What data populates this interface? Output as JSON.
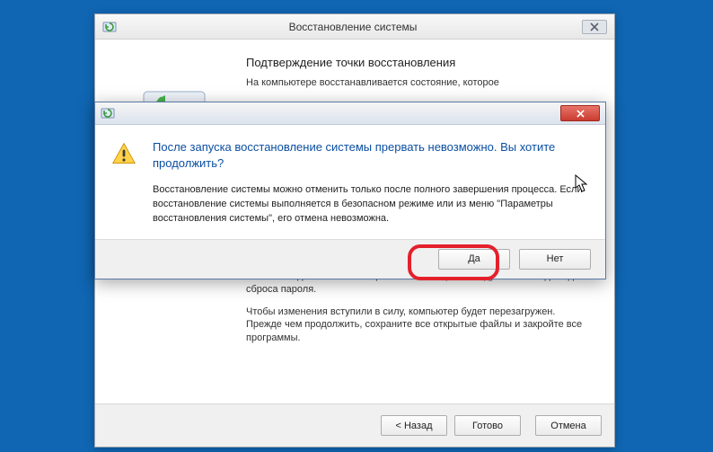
{
  "main": {
    "title": "Восстановление системы",
    "heading": "Подтверждение точки восстановления",
    "intro": "На компьютере восстанавливается состояние, которое",
    "note1": "Если вы недавно меняли пароль Windows, рекомендуем вам создать диск сброса пароля.",
    "note2": "Чтобы изменения вступили в силу, компьютер будет перезагружен. Прежде чем продолжить, сохраните все открытые файлы и закройте все программы.",
    "buttons": {
      "back": "< Назад",
      "finish": "Готово",
      "cancel": "Отмена"
    }
  },
  "dialog": {
    "heading": "После запуска восстановление системы прервать невозможно. Вы хотите продолжить?",
    "body": "Восстановление системы можно отменить только после полного завершения процесса. Если восстановление системы выполняется в безопасном режиме или из меню \"Параметры восстановления системы\", его отмена невозможна.",
    "buttons": {
      "yes": "Да",
      "no": "Нет"
    }
  }
}
